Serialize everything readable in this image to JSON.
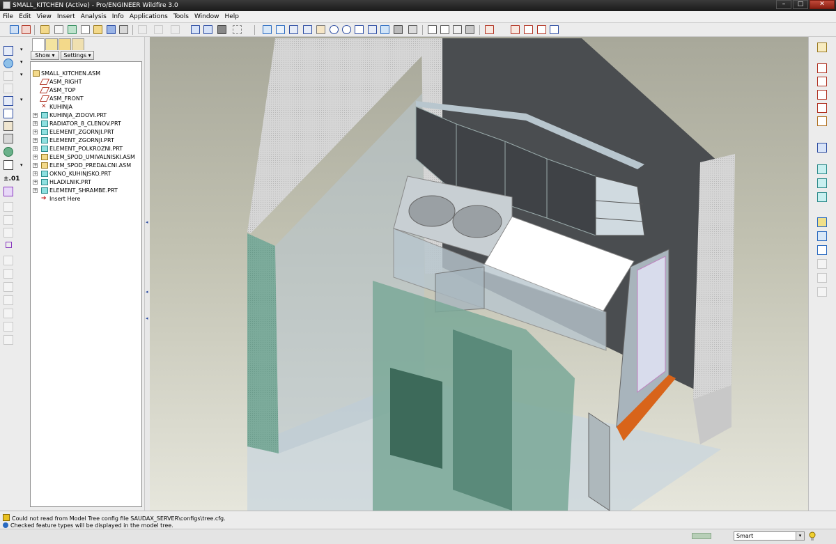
{
  "window": {
    "title": "SMALL_KITCHEN (Active) - Pro/ENGINEER Wildfire 3.0",
    "controls": [
      "–",
      "□",
      "✕"
    ]
  },
  "menu": [
    "File",
    "Edit",
    "View",
    "Insert",
    "Analysis",
    "Info",
    "Applications",
    "Tools",
    "Window",
    "Help"
  ],
  "left_tools": {
    "precision_label": "±.01"
  },
  "panel": {
    "show_label": "Show ▾",
    "settings_label": "Settings ▾"
  },
  "model_tree": [
    {
      "label": "SMALL_KITCHEN.ASM",
      "icon": "assembly-icon",
      "expander": false
    },
    {
      "label": "ASM_RIGHT",
      "icon": "datum-plane-icon",
      "expander": false
    },
    {
      "label": "ASM_TOP",
      "icon": "datum-plane-icon",
      "expander": false
    },
    {
      "label": "ASM_FRONT",
      "icon": "datum-plane-icon",
      "expander": false
    },
    {
      "label": "KUHINJA",
      "icon": "coordinate-system-icon",
      "expander": false
    },
    {
      "label": "KUHINJA_ZIDOVI.PRT",
      "icon": "part-icon",
      "expander": true
    },
    {
      "label": "RADIATOR_8_CLENOV.PRT",
      "icon": "part-icon",
      "expander": true
    },
    {
      "label": "ELEMENT_ZGORNJI.PRT",
      "icon": "part-icon",
      "expander": true
    },
    {
      "label": "ELEMENT_ZGORNJI.PRT",
      "icon": "part-icon",
      "expander": true
    },
    {
      "label": "ELEMENT_POLKROZNI.PRT",
      "icon": "part-icon",
      "expander": true
    },
    {
      "label": "ELEM_SPOD_UMIVALNISKI.ASM",
      "icon": "assembly-icon",
      "expander": true
    },
    {
      "label": "ELEM_SPOD_PREDALCNI.ASM",
      "icon": "assembly-icon",
      "expander": true
    },
    {
      "label": "OKNO_KUHINJSKO.PRT",
      "icon": "part-icon",
      "expander": true
    },
    {
      "label": "HLADILNIK.PRT",
      "icon": "part-icon",
      "expander": true
    },
    {
      "label": "ELEMENT_SHRAMBE.PRT",
      "icon": "part-icon",
      "expander": true
    },
    {
      "label": "Insert Here",
      "icon": "insert-here-arrow-icon",
      "expander": false
    }
  ],
  "messages": [
    "Could not read from Model Tree config file SAUDAX_SERVER\\configs\\tree.cfg.",
    "Checked feature types will be displayed in the model tree."
  ],
  "status": {
    "filter_value": "Smart"
  },
  "colors": {
    "wall_light": "#d8d8d8",
    "wall_dark": "#4a4d50",
    "glass_teal": "#7aa898",
    "counter_white": "#ffffff",
    "window_sill": "#d8641a",
    "viewport_bg_top": "#a8a89a"
  }
}
